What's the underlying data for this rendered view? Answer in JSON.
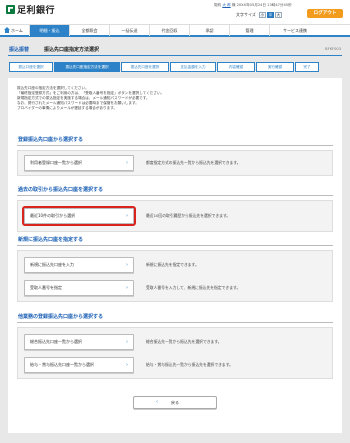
{
  "header": {
    "bank_name": "足利銀行",
    "user_prefix": "契約",
    "user_name": "大 郎",
    "user_suffix": "様",
    "last_login": "20XX年05月24日 13時47分45秒",
    "font_size_label": "文字サイズ",
    "font_sizes": [
      "小",
      "中",
      "大"
    ],
    "logout_label": "ログアウト"
  },
  "nav": {
    "items": [
      "ホーム",
      "明細・振込",
      "全都照会",
      "一括伝送",
      "代金回収",
      "承認",
      "管理",
      "サービス連携"
    ]
  },
  "page": {
    "section": "振込振替",
    "title": "振込先口座指定方法選択",
    "screen_id": "BFKF003"
  },
  "steps": [
    "振込口座を選択",
    "振込先口座指定方法を選択",
    "振込先口座を選択",
    "支払金額を入力",
    "内容確認",
    "実行確認",
    "完了"
  ],
  "intro": {
    "line1": "振込先口座の指定方法を選択してください。",
    "line2": "「最終指定登録方式」をご利用の方は、「受取人番号を指定」ボタンを選択してください。",
    "line3": "新規指定方式での振込指定を実施する場合は、メール通知パスワードが必要です。",
    "line4": "なお、発行されたメール通知パスワードは必要時まで保管をお願いします。",
    "line5": "プロバイダーの事情によりメールが遅延する場合があります。"
  },
  "sections": {
    "registered": {
      "title": "登録振込先口座から選択する",
      "button": "利用者登録口座一覧から選択",
      "desc": "都度指定方式の振込先一覧から振込先を選択できます。"
    },
    "history": {
      "title": "過去の取引から振込先口座を選択する",
      "button": "最近10件の取引から選択",
      "desc": "最近10回の取引履歴から振込先を選択できます。"
    },
    "new": {
      "title": "新規に振込先口座を指定する",
      "button1": "新規に振込先口座を入力",
      "desc1": "新規に振込先を指定できます。",
      "button2": "受取人番号を指定",
      "desc2": "受取人番号を入力して、新規に振込先を指定できます。"
    },
    "other": {
      "title": "他業務の登録振込先口座から選択する",
      "button1": "総合振込先口座一覧から選択",
      "desc1": "総合振込先一覧から振込先を選択できます。",
      "button2": "給与・賞与振込先口座一覧から選択",
      "desc2": "給与・賞与振込先一覧から振込先を選択できます。"
    }
  },
  "back_label": "戻る",
  "colors": {
    "primary": "#2e83c8",
    "brand_green": "#0a7a3e",
    "logout": "#f29b1d",
    "highlight": "#d9231f"
  }
}
